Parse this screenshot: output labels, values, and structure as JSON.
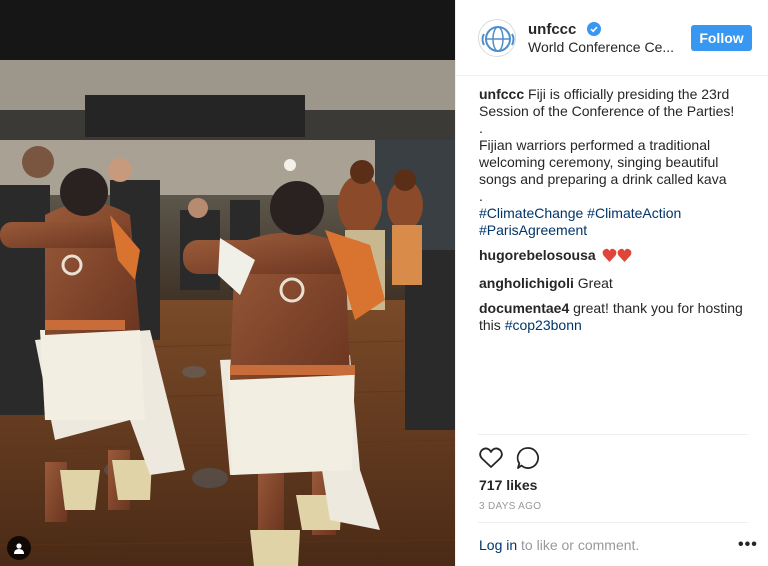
{
  "post": {
    "username": "unfccc",
    "location": "World Conference Ce...",
    "follow_label": "Follow",
    "caption_username": "unfccc",
    "caption_line1": "Fiji is officially presiding the 23rd Session of the Conference of the Parties!",
    "caption_dot1": ".",
    "caption_line2": "Fijian warriors performed a traditional welcoming ceremony, singing beautiful songs and preparing a drink called kava",
    "caption_dot2": ".",
    "hashtags": "#ClimateChange #ClimateAction #ParisAgreement",
    "likes": "717 likes",
    "timestamp": "3 DAYS AGO"
  },
  "comments": [
    {
      "username": "hugorebelosousa",
      "text": ""
    },
    {
      "username": "angholichigoli",
      "text": "Great"
    },
    {
      "username": "documentae4",
      "text": "great! thank you for hosting this ",
      "tag": "#cop23bonn"
    }
  ],
  "footer": {
    "login_link": "Log in",
    "login_rest": " to like or comment.",
    "more_label": "•••"
  },
  "colors": {
    "follow_button": "#3897f0",
    "link": "#003569",
    "verified": "#3897f0",
    "heart_emoji": "#e0453a"
  },
  "icons": [
    "unfccc-logo-icon",
    "verified-badge-icon",
    "heart-outline-icon",
    "comment-bubble-icon",
    "heart-emoji-icon",
    "user-tag-icon",
    "more-options-icon"
  ]
}
